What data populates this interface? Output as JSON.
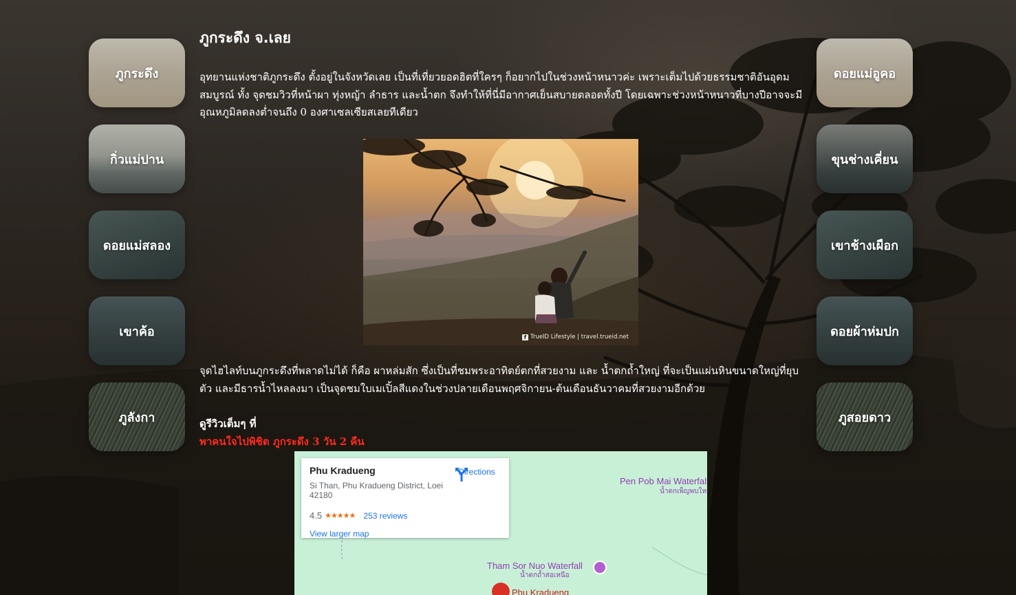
{
  "page": {
    "title": "ภูกระดึง จ.เลย",
    "paragraph1": "อุทยานแห่งชาติภูกระดึง ตั้งอยู่ในจังหวัดเลย เป็นที่เที่ยวยอดฮิตที่ใครๆ ก็อยากไปในช่วงหน้าหนาวค่ะ เพราะเต็มไปด้วยธรรมชาติอันอุดมสมบูรณ์ ทั้ง จุดชมวิวที่หน้าผา ทุ่งหญ้า ลำธาร และน้ำตก จึงทำให้ที่นี่มีอากาศเย็นสบายตลอดทั้งปี โดยเฉพาะช่วงหน้าหนาวที่บางปีอาจจะมีอุณหภูมิลดลงต่ำจนถึง 0 องศาเซลเซียสเลยทีเดียว",
    "paragraph2": "จุดไฮไลท์บนภูกระดึงที่พลาดไม่ได้ ก็คือ ผาหล่มสัก ซึ่งเป็นที่ชมพระอาทิตย์ตกที่สวยงาม และ น้ำตกถ้ำใหญ่ ที่จะเป็นแผ่นหินขนาดใหญ่ที่ยุบตัว และมีธารน้ำไหลลงมา เป็นจุดชมใบเมเปิ้ลสีแดงในช่วงปลายเดือนพฤศจิกายน-ต้นเดือนธันวาคมที่สวยงามอีกด้วย",
    "review_prefix": "ดูรีวิวเต็มๆ ที่",
    "review_link": "พาคนใจไปพิชิต ภูกระดึง 3 วัน 2 คืน",
    "link_color": "#ff2a1f"
  },
  "left_cards": [
    {
      "label": "ภูกระดึง"
    },
    {
      "label": "กิ่วแม่ปาน"
    },
    {
      "label": "ดอยแม่สลอง"
    },
    {
      "label": "เขาค้อ"
    },
    {
      "label": "ภูลังกา"
    }
  ],
  "right_cards": [
    {
      "label": "ดอยแม่อูคอ"
    },
    {
      "label": "ขุนช่างเคี่ยน"
    },
    {
      "label": "เขาช้างเผือก"
    },
    {
      "label": "ดอยผ้าห่มปก"
    },
    {
      "label": "ภูสอยดาว"
    }
  ],
  "photo": {
    "credit": "TrueID Lifestyle | travel.trueid.net",
    "credit_icon": "facebook-icon"
  },
  "map": {
    "place_name": "Phu Kradueng",
    "address": "Si Than, Phu Kradueng District, Loei 42180",
    "rating": "4.5",
    "stars": "★★★★★",
    "reviews": "253 reviews",
    "view_larger": "View larger map",
    "directions": "Directions",
    "poi_1": "Pen Pob Mai Waterfall",
    "poi_1_thai": "น้ำตกเพ็ญพบใหม่",
    "poi_2": "Tham Sor Nuo Waterfall",
    "poi_2_thai": "น้ำตกถ้ำสอเหนือ",
    "pin_label": "Phu Kradueng",
    "land_color": "#c8f0d7",
    "accent_color": "#1a73e8"
  }
}
